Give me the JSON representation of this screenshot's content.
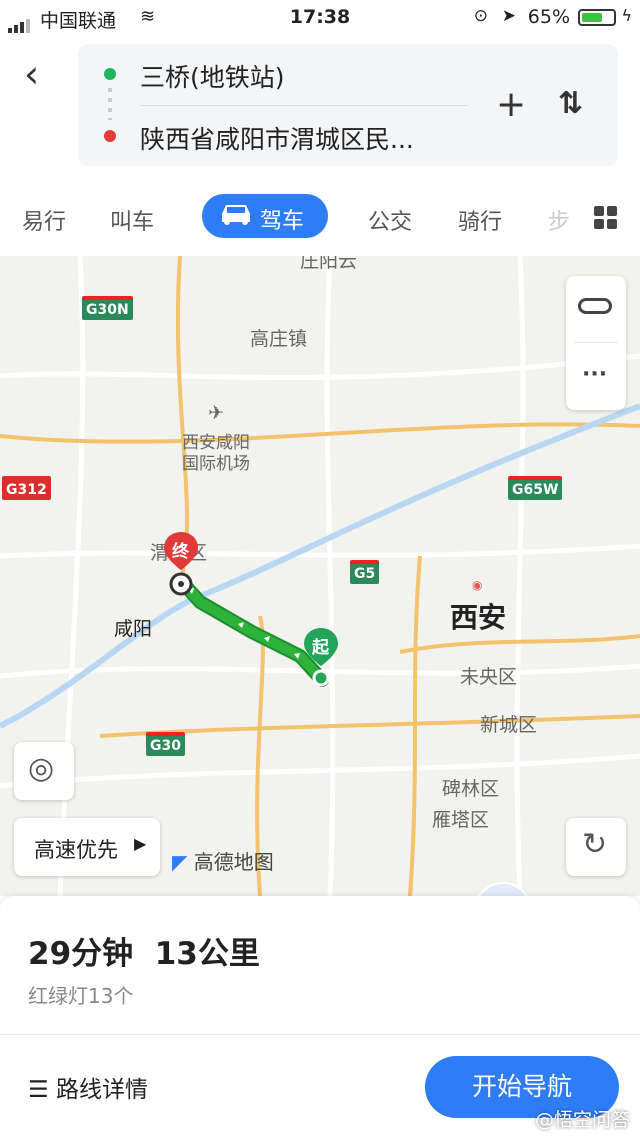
{
  "status": {
    "carrier": "中国联通",
    "time": "17:38",
    "battery": "65%",
    "battery_level": 0.65
  },
  "route": {
    "from": "三桥(地铁站)",
    "to": "陕西省咸阳市渭城区民..."
  },
  "modes": [
    "易行",
    "叫车",
    "驾车",
    "公交",
    "骑行",
    "步"
  ],
  "map": {
    "labels": {
      "gaozhuang": "高庄镇",
      "airport1": "西安咸阳",
      "airport2": "国际机场",
      "xianyang": "咸阳",
      "xian": "西安",
      "weicheng": "渭城区",
      "weiyang": "未央区",
      "xincheng": "新城区",
      "beilin": "碑林区",
      "yanta": "雁塔区",
      "top": "庄阳云"
    },
    "shields": {
      "g30n": "G30N",
      "g312": "G312",
      "g65w": "G65W",
      "g5": "G5",
      "g30": "G30"
    },
    "start_marker": "起",
    "end_marker": "终",
    "priority": "高速优先",
    "brand": "高德地图",
    "route_color": "#2db33b"
  },
  "panel": {
    "summary": "29分钟  13公里",
    "lights": "红绿灯13个",
    "details": "路线详情",
    "start": "开始导航"
  },
  "watermark": "@悟空问答"
}
